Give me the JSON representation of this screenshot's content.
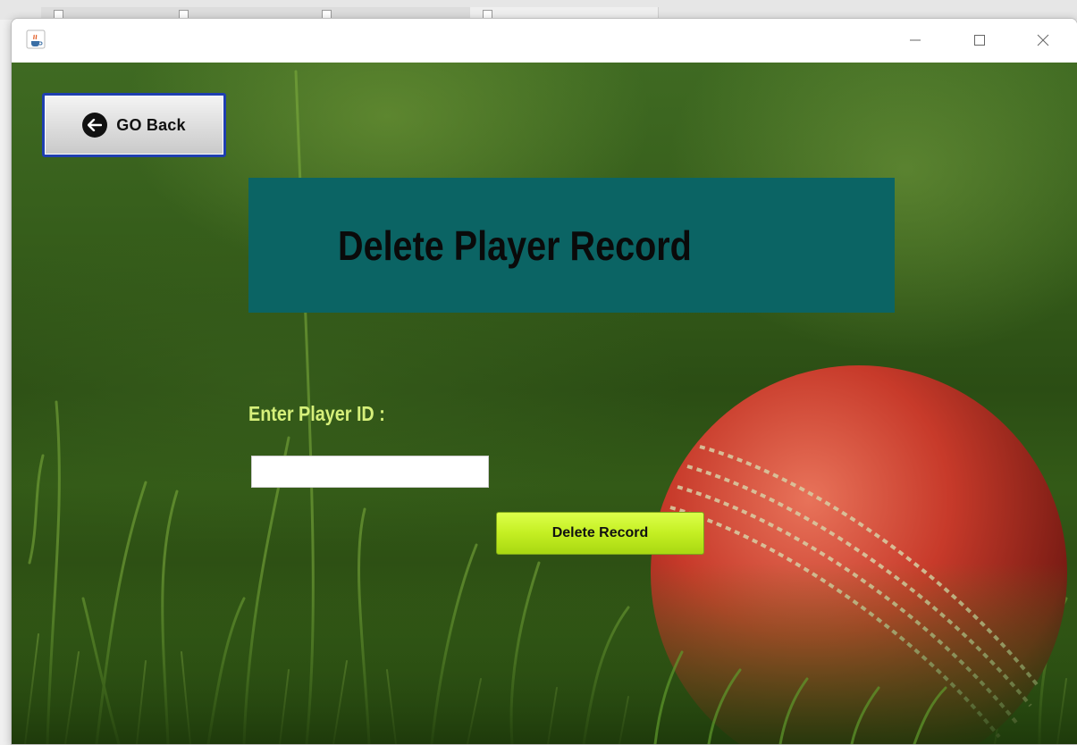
{
  "window": {
    "app_icon": "java-coffee-icon",
    "controls": {
      "minimize": "minimize-icon",
      "maximize": "maximize-icon",
      "close": "close-icon"
    }
  },
  "form": {
    "back_button_label": "GO Back",
    "back_icon": "arrow-left-circle-icon",
    "heading": "Delete Player Record",
    "player_id_label": "Enter Player ID :",
    "player_id_value": "",
    "delete_button_label": "Delete Record"
  },
  "colors": {
    "title_panel": "#0b6464",
    "label_text": "#d6f07a",
    "delete_button": "#c4ef22",
    "back_button_border": "#1f3fb0"
  }
}
